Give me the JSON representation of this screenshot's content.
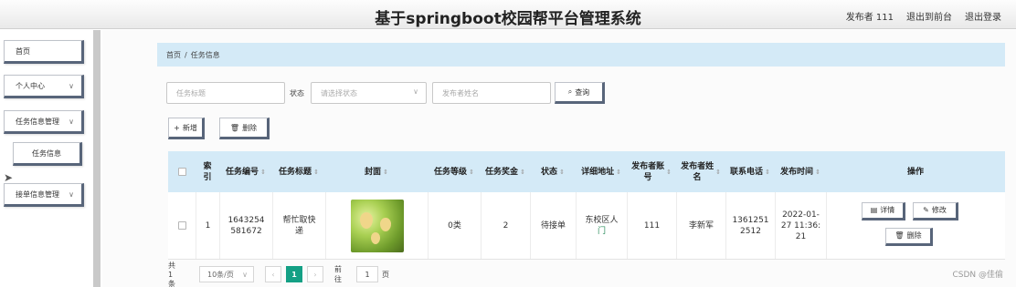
{
  "header": {
    "title": "基于springboot校园帮平台管理系统",
    "publisher": "发布者 111",
    "exit_front": "退出到前台",
    "logout": "退出登录"
  },
  "sidebar": {
    "items": [
      {
        "label": "首页"
      },
      {
        "label": "个人中心"
      },
      {
        "label": "任务信息管理"
      },
      {
        "label": "任务信息"
      },
      {
        "label": "接单信息管理"
      }
    ]
  },
  "breadcrumb": {
    "home": "首页",
    "sep": "/",
    "current": "任务信息"
  },
  "search": {
    "title_placeholder": "任务标题",
    "state_label": "状态",
    "state_placeholder": "请选择状态",
    "name_placeholder": "发布者姓名",
    "search_button": "查询"
  },
  "toolbar": {
    "add_label": "新增",
    "delete_label": "删除"
  },
  "table": {
    "headers": {
      "index": "索引",
      "task_no": "任务编号",
      "task_title": "任务标题",
      "cover": "封面",
      "level": "任务等级",
      "reward": "任务奖金",
      "status": "状态",
      "address": "详细地址",
      "account": "发布者账号",
      "name": "发布者姓名",
      "phone": "联系电话",
      "time": "发布时间",
      "ops": "操作"
    },
    "rows": [
      {
        "index": "1",
        "task_no": "1643254581672",
        "task_title": "帮忙取快递",
        "level": "0类",
        "reward": "2",
        "status": "待接单",
        "address_line1": "东校区人",
        "address_line2": "门",
        "account": "111",
        "name": "李新军",
        "phone": "13612512512",
        "time": "2022-01-27 11:36:21",
        "detail_label": "详情",
        "edit_label": "修改",
        "delete_label": "删除"
      }
    ]
  },
  "pagination": {
    "total": "共1条",
    "page_size": "10条/页",
    "current_page": "1",
    "goto_prefix": "前往",
    "goto_value": "1",
    "goto_suffix": "页"
  },
  "watermark": "CSDN @佳偷",
  "colors": {
    "accent": "#14a085",
    "header_blue": "#d4eaf7",
    "button_border": "#58657a"
  }
}
